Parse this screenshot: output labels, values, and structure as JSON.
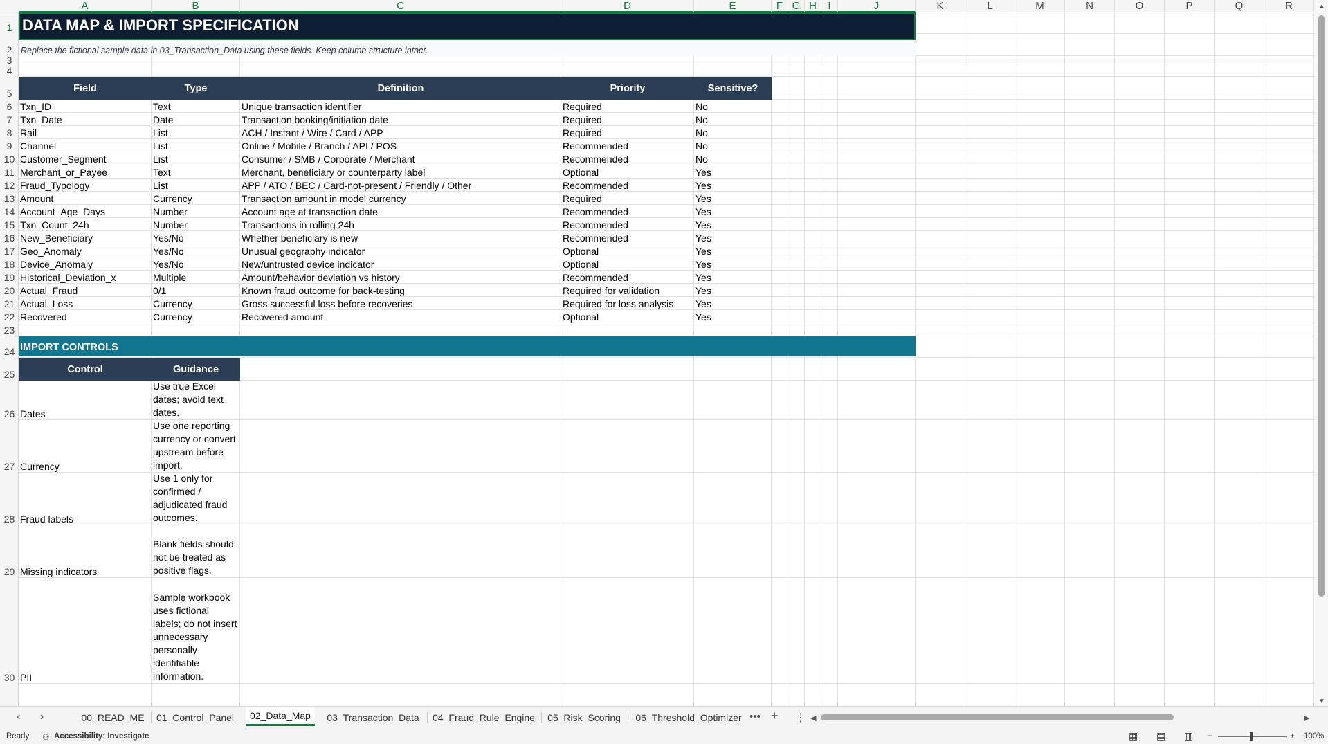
{
  "columns": [
    "A",
    "B",
    "C",
    "D",
    "E",
    "F",
    "G",
    "H",
    "I",
    "J",
    "K",
    "L",
    "M",
    "N",
    "O",
    "P",
    "Q",
    "R"
  ],
  "rows": [
    "1",
    "2",
    "3",
    "4",
    "5",
    "6",
    "7",
    "8",
    "9",
    "10",
    "11",
    "12",
    "13",
    "14",
    "15",
    "16",
    "17",
    "18",
    "19",
    "20",
    "21",
    "22",
    "23",
    "24",
    "25",
    "26",
    "27",
    "28",
    "29",
    "30"
  ],
  "title": "DATA MAP & IMPORT SPECIFICATION",
  "subtitle": "Replace the fictional sample data in 03_Transaction_Data using these fields. Keep column structure intact.",
  "field_table": {
    "headers": [
      "Field",
      "Type",
      "Definition",
      "Priority",
      "Sensitive?"
    ],
    "rows": [
      [
        "Txn_ID",
        "Text",
        "Unique transaction identifier",
        "Required",
        "No"
      ],
      [
        "Txn_Date",
        "Date",
        "Transaction booking/initiation date",
        "Required",
        "No"
      ],
      [
        "Rail",
        "List",
        "ACH / Instant / Wire / Card / APP",
        "Required",
        "No"
      ],
      [
        "Channel",
        "List",
        "Online / Mobile / Branch / API / POS",
        "Recommended",
        "No"
      ],
      [
        "Customer_Segment",
        "List",
        "Consumer / SMB / Corporate / Merchant",
        "Recommended",
        "No"
      ],
      [
        "Merchant_or_Payee",
        "Text",
        "Merchant, beneficiary or counterparty label",
        "Optional",
        "Yes"
      ],
      [
        "Fraud_Typology",
        "List",
        "APP / ATO / BEC / Card-not-present / Friendly / Other",
        "Recommended",
        "Yes"
      ],
      [
        "Amount",
        "Currency",
        "Transaction amount in model currency",
        "Required",
        "Yes"
      ],
      [
        "Account_Age_Days",
        "Number",
        "Account age at transaction date",
        "Recommended",
        "Yes"
      ],
      [
        "Txn_Count_24h",
        "Number",
        "Transactions in rolling 24h",
        "Recommended",
        "Yes"
      ],
      [
        "New_Beneficiary",
        "Yes/No",
        "Whether beneficiary is new",
        "Recommended",
        "Yes"
      ],
      [
        "Geo_Anomaly",
        "Yes/No",
        "Unusual geography indicator",
        "Optional",
        "Yes"
      ],
      [
        "Device_Anomaly",
        "Yes/No",
        "New/untrusted device indicator",
        "Optional",
        "Yes"
      ],
      [
        "Historical_Deviation_x",
        "Multiple",
        "Amount/behavior deviation vs history",
        "Recommended",
        "Yes"
      ],
      [
        "Actual_Fraud",
        "0/1",
        "Known fraud outcome for back-testing",
        "Required for validation",
        "Yes"
      ],
      [
        "Actual_Loss",
        "Currency",
        "Gross successful loss before recoveries",
        "Required for loss analysis",
        "Yes"
      ],
      [
        "Recovered",
        "Currency",
        "Recovered amount",
        "Optional",
        "Yes"
      ]
    ]
  },
  "import_controls": {
    "section_title": "IMPORT CONTROLS",
    "headers": [
      "Control",
      "Guidance"
    ],
    "rows": [
      [
        "Dates",
        "Use true Excel dates; avoid text dates."
      ],
      [
        "Currency",
        "Use one reporting currency or convert upstream before import."
      ],
      [
        "Fraud labels",
        "Use 1 only for confirmed / adjudicated fraud outcomes."
      ],
      [
        "Missing indicators",
        "Blank fields should not be treated as positive flags."
      ],
      [
        "PII",
        "Sample workbook uses fictional labels; do not insert unnecessary personally identifiable information."
      ]
    ]
  },
  "sheet_tabs": [
    "00_READ_ME",
    "01_Control_Panel",
    "02_Data_Map",
    "03_Transaction_Data",
    "04_Fraud_Rule_Engine",
    "05_Risk_Scoring",
    "06_Threshold_Optimizer"
  ],
  "active_tab": "02_Data_Map",
  "status": {
    "ready": "Ready",
    "accessibility": "Accessibility: Investigate",
    "zoom": "100%"
  },
  "colors": {
    "title_bg": "#0e1e33",
    "header_bg": "#2c3e55",
    "section_bg": "#137690",
    "accent": "#107c41"
  }
}
